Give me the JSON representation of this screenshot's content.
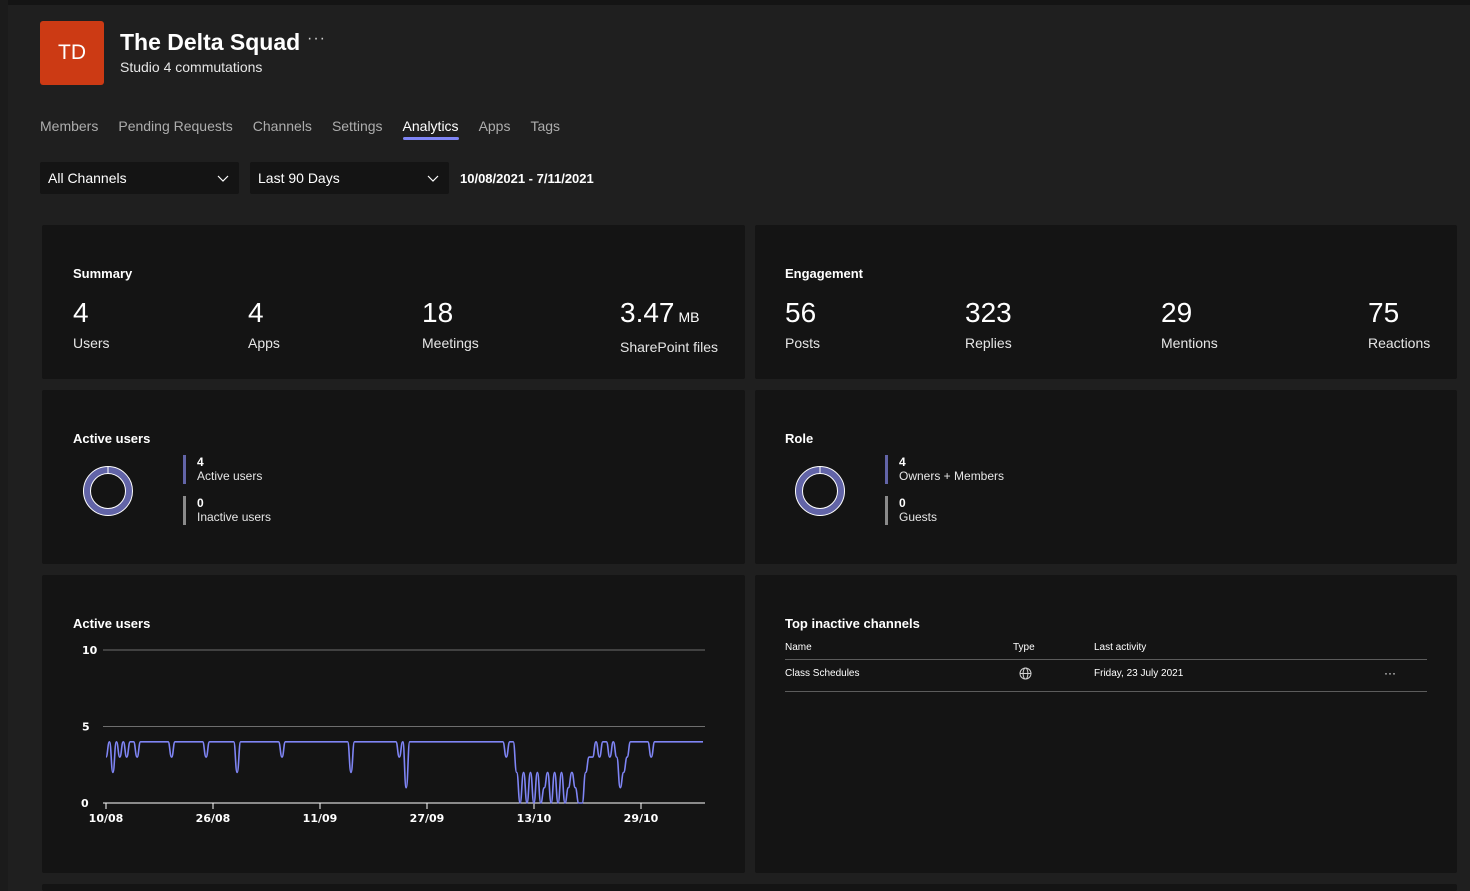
{
  "team": {
    "initials": "TD",
    "name": "The Delta Squad",
    "description": "Studio 4 commutations",
    "more_label": "···"
  },
  "tabs": [
    {
      "label": "Members",
      "active": false
    },
    {
      "label": "Pending Requests",
      "active": false
    },
    {
      "label": "Channels",
      "active": false
    },
    {
      "label": "Settings",
      "active": false
    },
    {
      "label": "Analytics",
      "active": true
    },
    {
      "label": "Apps",
      "active": false
    },
    {
      "label": "Tags",
      "active": false
    }
  ],
  "filters": {
    "channel": "All Channels",
    "period": "Last 90 Days",
    "date_range": "10/08/2021 - 7/11/2021"
  },
  "summary": {
    "title": "Summary",
    "users": {
      "value": "4",
      "label": "Users"
    },
    "apps": {
      "value": "4",
      "label": "Apps"
    },
    "meetings": {
      "value": "18",
      "label": "Meetings"
    },
    "sharepoint": {
      "value": "3.47",
      "unit": "MB",
      "label": "SharePoint files"
    }
  },
  "engagement": {
    "title": "Engagement",
    "posts": {
      "value": "56",
      "label": "Posts"
    },
    "replies": {
      "value": "323",
      "label": "Replies"
    },
    "mentions": {
      "value": "29",
      "label": "Mentions"
    },
    "reactions": {
      "value": "75",
      "label": "Reactions"
    }
  },
  "active_users_donut": {
    "title": "Active users",
    "active": {
      "value": "4",
      "label": "Active users"
    },
    "inactive": {
      "value": "0",
      "label": "Inactive users"
    }
  },
  "role_donut": {
    "title": "Role",
    "owners": {
      "value": "4",
      "label": "Owners + Members"
    },
    "guests": {
      "value": "0",
      "label": "Guests"
    }
  },
  "colors": {
    "accent": "#7f85f5",
    "donut": "#6264a7",
    "inactive": "#8a8a8a",
    "avatar": "#cc3a14",
    "card": "#141414",
    "background": "#1f1f1f"
  },
  "chart_data": {
    "type": "line",
    "title": "Active users",
    "ylim": [
      0,
      10
    ],
    "yticks": [
      "10",
      "5",
      "0"
    ],
    "xticks": [
      "10/08",
      "26/08",
      "11/09",
      "27/09",
      "13/10",
      "29/10"
    ],
    "grid": true,
    "series": [
      {
        "values": [
          3,
          4,
          2,
          4,
          3,
          4,
          3,
          4,
          4,
          3,
          4,
          4,
          4,
          4,
          4,
          4,
          4,
          4,
          4,
          3,
          4,
          4,
          4,
          4,
          4,
          4,
          4,
          4,
          4,
          3,
          4,
          4,
          4,
          4,
          4,
          4,
          4,
          4,
          2,
          4,
          4,
          4,
          4,
          4,
          4,
          4,
          4,
          4,
          4,
          4,
          4,
          3,
          4,
          4,
          4,
          4,
          4,
          4,
          4,
          4,
          4,
          4,
          4,
          4,
          4,
          4,
          4,
          4,
          4,
          4,
          4,
          2,
          4,
          4,
          4,
          4,
          4,
          4,
          4,
          4,
          4,
          4,
          4,
          4,
          4,
          3,
          4,
          1,
          4,
          4,
          4,
          4,
          4,
          4,
          4,
          4,
          4,
          4,
          4,
          4,
          4,
          4,
          4,
          4,
          4,
          4,
          4,
          4,
          4,
          4,
          4,
          4,
          4,
          4,
          4,
          4,
          3,
          4,
          4,
          2,
          0,
          2,
          0,
          2,
          0,
          2,
          0,
          1,
          2,
          0,
          2,
          0,
          2,
          0,
          1,
          2,
          1,
          0,
          0,
          2,
          3,
          3,
          4,
          3,
          4,
          4,
          3,
          4,
          3,
          1,
          2,
          3,
          4,
          4,
          4,
          4,
          4,
          4,
          3,
          4,
          4,
          4,
          4,
          4,
          4,
          4,
          4,
          4,
          4,
          4,
          4,
          4,
          4,
          4
        ]
      }
    ]
  },
  "inactive_channels": {
    "title": "Top inactive channels",
    "columns": [
      "Name",
      "Type",
      "Last activity"
    ],
    "rows": [
      {
        "name": "Class Schedules",
        "type_icon": "globe-icon",
        "last_activity": "Friday, 23 July 2021",
        "more": "···"
      }
    ]
  }
}
